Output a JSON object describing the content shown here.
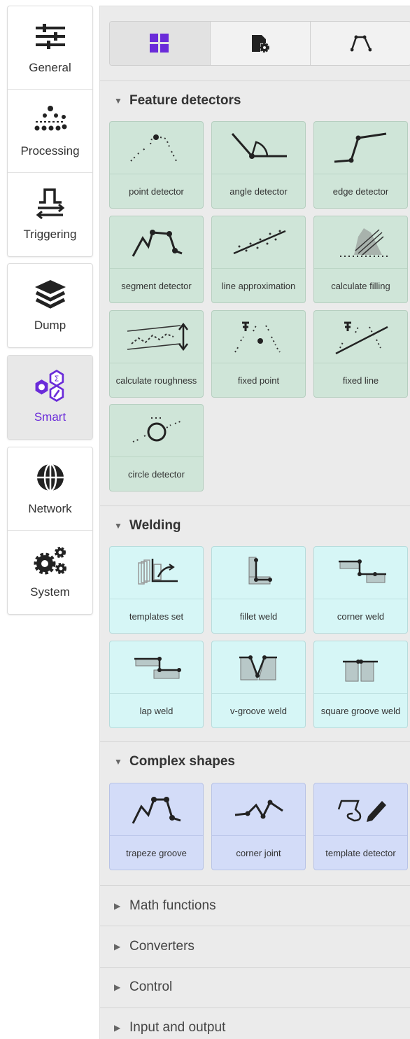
{
  "nav": {
    "general": "General",
    "processing": "Processing",
    "triggering": "Triggering",
    "dump": "Dump",
    "smart": "Smart",
    "network": "Network",
    "system": "System"
  },
  "colors": {
    "accent": "#6a2bd9",
    "feature_tile": "#cfe5d8",
    "welding_tile": "#d6f6f6",
    "complex_tile": "#d3dcf8"
  },
  "mode_tabs": [
    "grid-icon",
    "settings-file-icon",
    "profile-icon"
  ],
  "sections": {
    "feature": {
      "title": "Feature detectors",
      "items": [
        "point detector",
        "angle detector",
        "edge detector",
        "segment detector",
        "line approximation",
        "calculate filling",
        "calculate roughness",
        "fixed point",
        "fixed line",
        "circle detector"
      ]
    },
    "welding": {
      "title": "Welding",
      "items": [
        "templates set",
        "fillet weld",
        "corner weld",
        "lap weld",
        "v-groove weld",
        "square groove weld"
      ]
    },
    "complex": {
      "title": "Complex shapes",
      "items": [
        "trapeze groove",
        "corner joint",
        "template detector"
      ]
    },
    "math": {
      "title": "Math functions"
    },
    "converters": {
      "title": "Converters"
    },
    "control": {
      "title": "Control"
    },
    "io": {
      "title": "Input and output"
    }
  }
}
